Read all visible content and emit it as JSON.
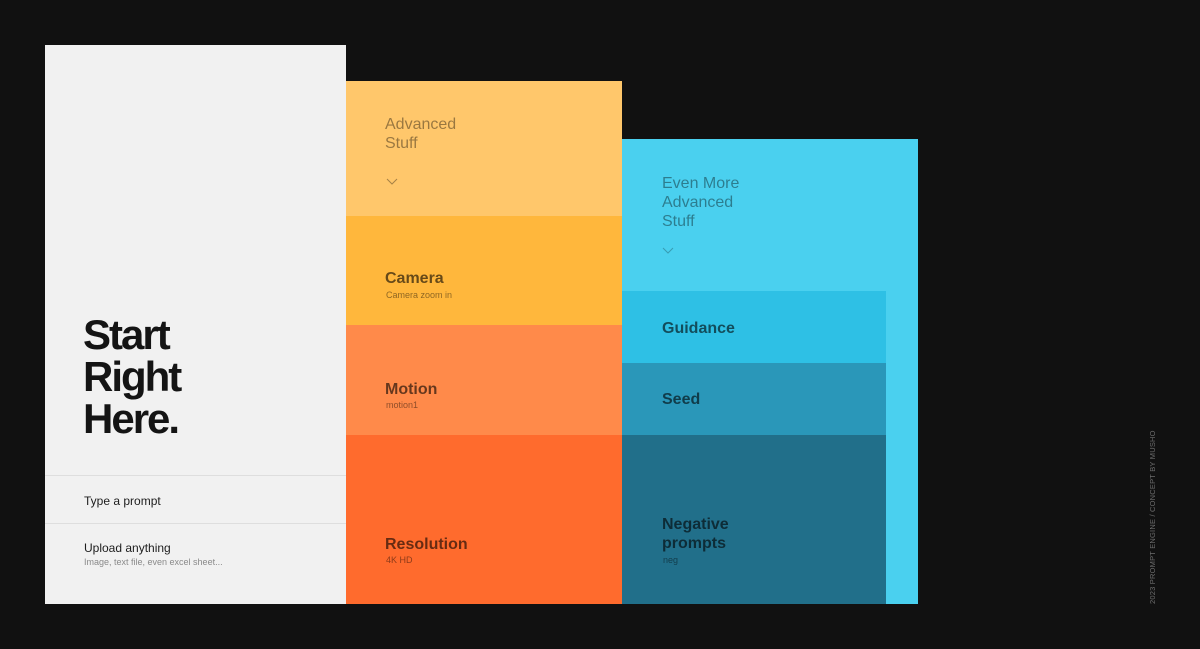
{
  "hero": {
    "line1": "Start",
    "line2": "Right",
    "line3": "Here."
  },
  "prompt_row": {
    "title": "Type a prompt"
  },
  "upload_row": {
    "title": "Upload anything",
    "subtitle": "Image, text file, even excel sheet..."
  },
  "advanced": {
    "line1": "Advanced",
    "line2": "Stuff"
  },
  "camera": {
    "label": "Camera",
    "value": "Camera zoom in"
  },
  "motion": {
    "label": "Motion",
    "value": "motion1"
  },
  "resolution": {
    "label": "Resolution",
    "value": "4K HD"
  },
  "more_advanced": {
    "line1": "Even More",
    "line2": "Advanced",
    "line3": "Stuff"
  },
  "guidance": {
    "label": "Guidance"
  },
  "seed": {
    "label": "Seed"
  },
  "negative": {
    "line1": "Negative",
    "line2": "prompts",
    "value": "neg"
  },
  "credit": "2023 PROMPT ENGINE  /  CONCEPT BY MUSHO",
  "colors": {
    "background": "#111111",
    "panel": "#f1f1f1",
    "orange_light": "#ffc76b",
    "orange": "#ffb73c",
    "orange_mid": "#ff8a4a",
    "orange_deep": "#ff6b2d",
    "blue_light": "#4ad0ef",
    "blue": "#2ec0e5",
    "blue_mid": "#2a97b9",
    "blue_deep": "#216f8a"
  },
  "icons": [
    "chevron-down-icon"
  ]
}
